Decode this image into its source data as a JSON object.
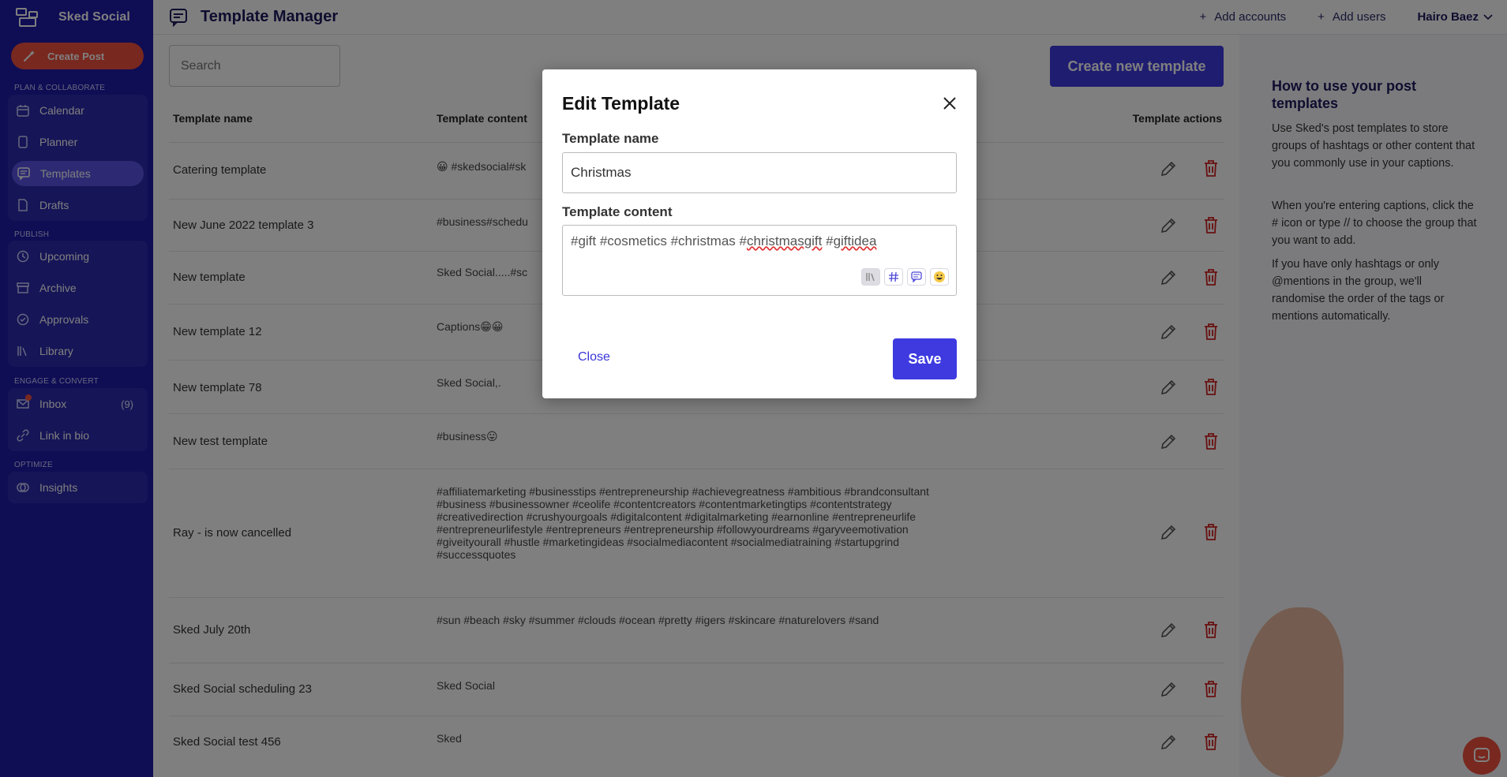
{
  "brand": {
    "name": "Sked Social"
  },
  "sidebar": {
    "create_post": "Create Post",
    "sections": [
      {
        "title": "PLAN & COLLABORATE",
        "items": [
          {
            "label": "Calendar"
          },
          {
            "label": "Planner"
          },
          {
            "label": "Templates"
          },
          {
            "label": "Drafts"
          }
        ]
      },
      {
        "title": "PUBLISH",
        "items": [
          {
            "label": "Upcoming"
          },
          {
            "label": "Archive"
          },
          {
            "label": "Approvals"
          },
          {
            "label": "Library"
          }
        ]
      },
      {
        "title": "ENGAGE & CONVERT",
        "items": [
          {
            "label": "Inbox",
            "count": "(9)"
          },
          {
            "label": "Link in bio"
          }
        ]
      },
      {
        "title": "OPTIMIZE",
        "items": [
          {
            "label": "Insights"
          }
        ]
      }
    ]
  },
  "header": {
    "title": "Template Manager",
    "add_accounts": "Add accounts",
    "add_users": "Add users",
    "user_name": "Hairo Baez"
  },
  "search": {
    "placeholder": "Search"
  },
  "create_template_label": "Create new template",
  "table": {
    "headers": {
      "name": "Template name",
      "content": "Template content",
      "actions": "Template actions"
    },
    "rows": [
      {
        "name": "Catering template",
        "content": "😀 #skedsocial#sk"
      },
      {
        "name": "New June 2022 template 3",
        "content": "#business#schedu"
      },
      {
        "name": "New template",
        "content": "Sked Social.....#sc"
      },
      {
        "name": "New template 12",
        "content": "Captions😁😀"
      },
      {
        "name": "New template 78",
        "content": "Sked Social,."
      },
      {
        "name": "New test template",
        "content": "#business😛"
      },
      {
        "name": "Ray - is now cancelled",
        "content": "#affiliatemarketing #businesstips #entrepreneurship #achievegreatness #ambitious #brandconsultant #business #businessowner #ceolife #contentcreators #contentmarketingtips #contentstrategy #creativedirection #crushyourgoals #digitalcontent #digitalmarketing #earnonline #entrepreneurlife #entrepreneurlifestyle #entrepreneurs #entrepreneurship #followyourdreams #garyveemotivation #giveityourall #hustle #marketingideas #socialmediacontent #socialmediatraining #startupgrind #successquotes"
      },
      {
        "name": "Sked July 20th",
        "content": "#sun #beach #sky #summer #clouds #ocean #pretty #igers #skincare #naturelovers #sand"
      },
      {
        "name": "Sked Social scheduling 23",
        "content": "Sked Social"
      },
      {
        "name": "Sked Social test 456",
        "content": "Sked"
      }
    ]
  },
  "help": {
    "title": "How to use your post templates",
    "p1": "Use Sked's post templates to store groups of hashtags or other content that you commonly use in your captions.",
    "p2": "When you're entering captions, click the # icon or type // to choose the group that you want to add.",
    "p3": "If you have only hashtags or only @mentions in the group, we'll randomise the order of the tags or mentions automatically."
  },
  "modal": {
    "title": "Edit Template",
    "name_label": "Template name",
    "name_value": "Christmas",
    "content_label": "Template content",
    "content_parts": [
      "#gift #cosmetics #christmas #",
      "christmasgift",
      " #",
      "giftidea"
    ],
    "close_label": "Close",
    "save_label": "Save"
  },
  "colors": {
    "sidebar": "#1e1aa8",
    "accent": "#3e3ae0",
    "create_post": "#f0513e",
    "delete": "#d32020"
  }
}
